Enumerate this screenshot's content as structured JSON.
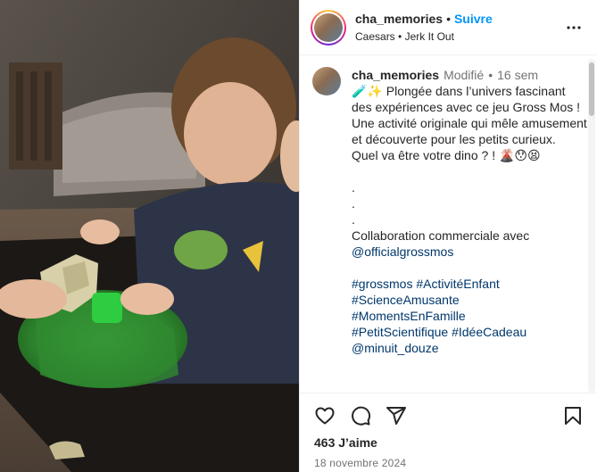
{
  "header": {
    "username": "cha_memories",
    "separator": "•",
    "follow_label": "Suivre",
    "audio_artist": "Caesars",
    "audio_sep": "•",
    "audio_title": "Jerk It Out",
    "more_icon": "more-horizontal-icon"
  },
  "caption": {
    "username": "cha_memories",
    "edited": "Modifié",
    "separator": "•",
    "age": "16 sem",
    "line1": "🧪✨ Plongée dans l’univers fascinant des expériences avec ce jeu Gross Mos !",
    "line2": "Une activité originale qui mêle amusement et découverte pour les petits curieux.",
    "line3": "Quel va être votre dino ? ! 🌋😯😫",
    "dot1": ".",
    "dot2": ".",
    "dot3": ".",
    "collab_text": "Collaboration commerciale avec",
    "collab_handle": "@officialgrossmos",
    "hashtags_line1": "#grossmos #ActivitéEnfant",
    "hashtags_line2": "#ScienceAmusante",
    "hashtags_line3": "#MomentsEnFamille",
    "hashtags_line4": "#PetitScientifique #IdéeCadeau",
    "mention": "@minuit_douze"
  },
  "actions": {
    "like_icon": "heart-icon",
    "comment_icon": "comment-icon",
    "share_icon": "send-icon",
    "save_icon": "bookmark-icon",
    "likes_text": "463 J’aime",
    "date_text": "18 novembre 2024"
  },
  "colors": {
    "accent": "#0095f6",
    "link": "#00376b",
    "muted": "#737373",
    "text": "#262626",
    "slime_green": "#2f8a2f"
  }
}
